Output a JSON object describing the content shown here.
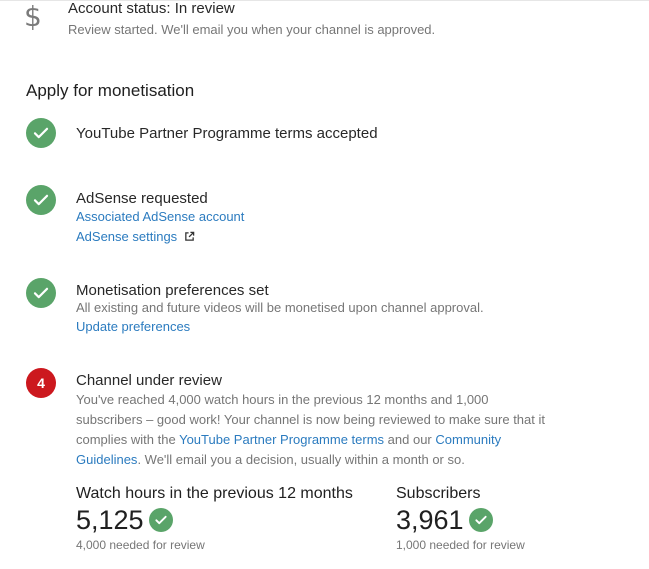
{
  "account": {
    "icon": "dollar-icon",
    "title": "Account status: In review",
    "description": "Review started. We'll email you when your channel is approved."
  },
  "section": {
    "title": "Apply for monetisation"
  },
  "steps": [
    {
      "status": "done",
      "title": "YouTube Partner Programme terms accepted"
    },
    {
      "status": "done",
      "title": "AdSense requested",
      "links": [
        "Associated AdSense account",
        "AdSense settings"
      ]
    },
    {
      "status": "done",
      "title": "Monetisation preferences set",
      "text": "All existing and future videos will be monetised upon channel approval.",
      "link": "Update preferences"
    },
    {
      "status": "current",
      "number": "4",
      "title": "Channel under review",
      "text_before": "You've reached 4,000 watch hours in the previous 12 months and 1,000 subscribers – good work! Your channel is now being reviewed to make sure that it complies with the ",
      "link1": "YouTube Partner Programme terms",
      "text_mid": " and our ",
      "link2": "Community Guidelines",
      "text_after": ". We'll email you a decision, usually within a month or so."
    }
  ],
  "stats": {
    "watch": {
      "label": "Watch hours in the previous 12 months",
      "value": "5,125",
      "note": "4,000 needed for review"
    },
    "subs": {
      "label": "Subscribers",
      "value": "3,961",
      "note": "1,000 needed for review"
    }
  },
  "colors": {
    "check_green": "#5aa469",
    "step_red": "#cc181e",
    "link_blue": "#2b7bbf"
  }
}
